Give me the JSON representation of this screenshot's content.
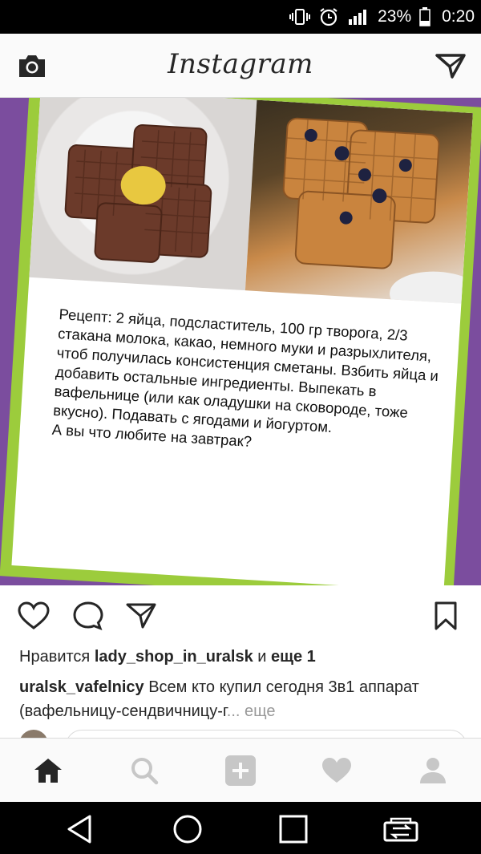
{
  "status_bar": {
    "battery_percent": "23%",
    "time": "0:20"
  },
  "header": {
    "brand": "Instagram"
  },
  "post": {
    "recipe_text": "Рецепт: 2 яйца, подсластитель, 100 гр творога, 2/3 стакана молока, какао, немного муки и разрыхлителя, чтоб получилась консистенция сметаны. Взбить яйца и добавить остальные ингредиенты. Выпекать в вафельнице (или как оладушки на сковороде, тоже вкусно). Подавать с ягодами и йогуртом.\nА вы что любите на завтрак?",
    "likes_prefix": "Нравится",
    "likes_user": "lady_shop_in_uralsk",
    "likes_conj": "и",
    "likes_more": "еще 1",
    "caption_user": "uralsk_vafelnicy",
    "caption_text": "Всем кто купил сегодня 3в1 аппарат (вафельницу-сендвичницу-г",
    "caption_more": "... еще"
  },
  "colors": {
    "purple": "#7b4d9e",
    "green": "#9ccc3c"
  },
  "icons": [
    "camera-icon",
    "direct-icon",
    "heart-icon",
    "comment-icon",
    "share-icon",
    "bookmark-icon",
    "home-icon",
    "search-icon",
    "add-icon",
    "activity-icon",
    "profile-icon"
  ]
}
